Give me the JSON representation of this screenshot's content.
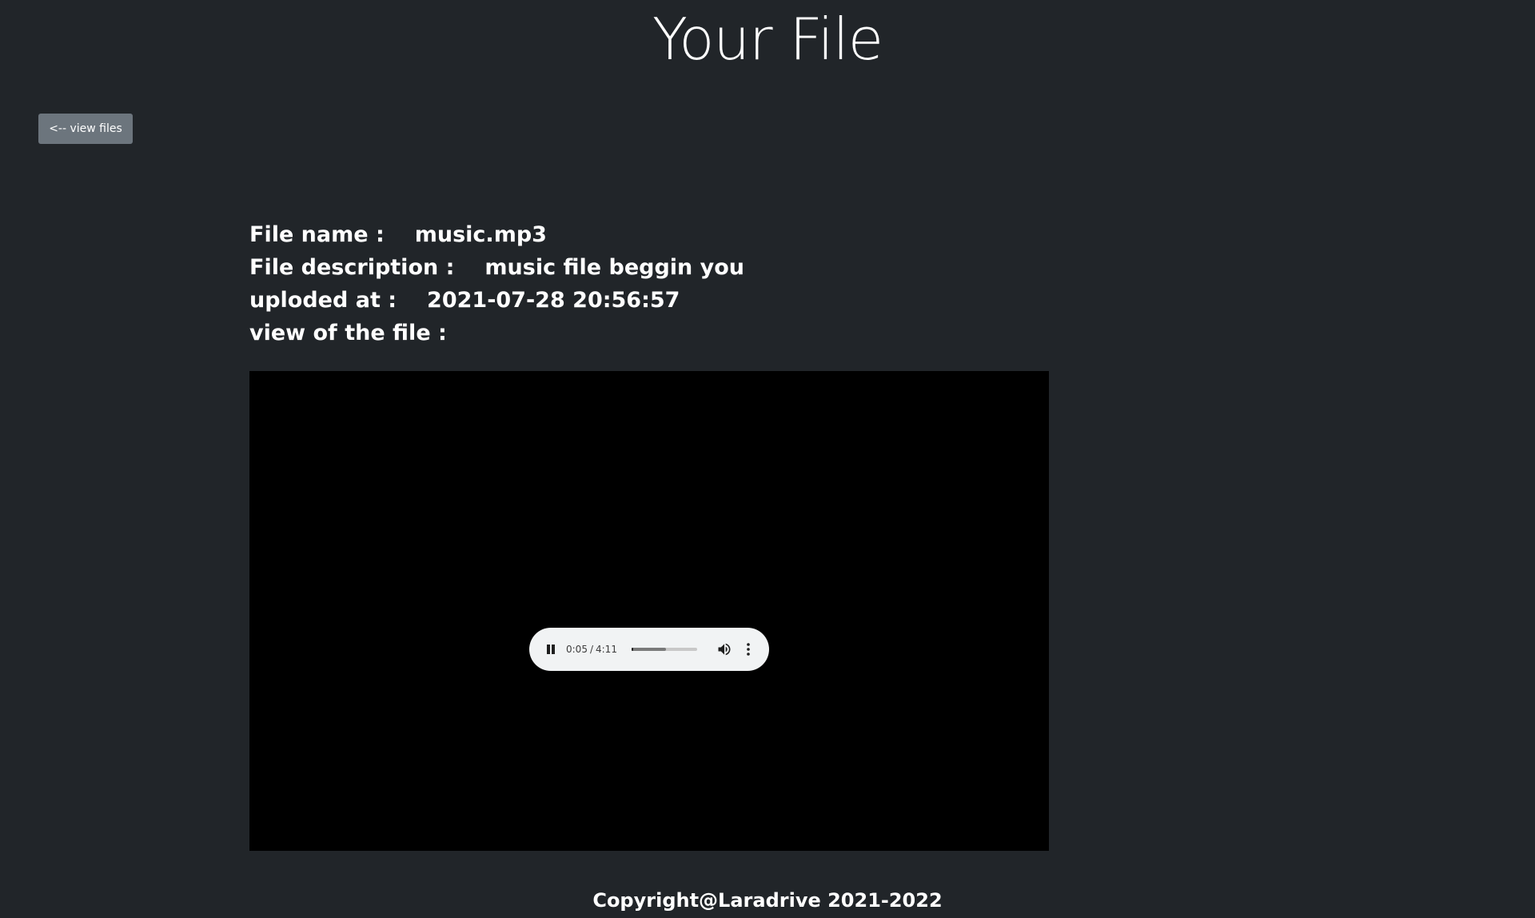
{
  "page": {
    "title": "Your File"
  },
  "nav": {
    "back_label": "<-- view files"
  },
  "file": {
    "name_label": "File name :",
    "name_value": "music.mp3",
    "description_label": "File description :",
    "description_value": "music file beggin you",
    "uploaded_label": "uploded at :",
    "uploaded_value": "2021-07-28 20:56:57",
    "view_label": "view of the file :"
  },
  "player": {
    "current_time": "0:05",
    "separator": "/",
    "duration": "4:11",
    "played_fraction": 0.02,
    "buffered_fraction": 0.53,
    "state": "playing",
    "pause_icon": "pause-icon",
    "volume_icon": "volume-icon",
    "menu_icon": "more-vertical-icon"
  },
  "footer": {
    "copyright": "Copyright@Laradrive 2021-2022"
  },
  "colors": {
    "background": "#212529",
    "button": "#6c757d",
    "text": "#ffffff",
    "player_bg": "#000000",
    "controls_bg": "#f1f3f4"
  }
}
